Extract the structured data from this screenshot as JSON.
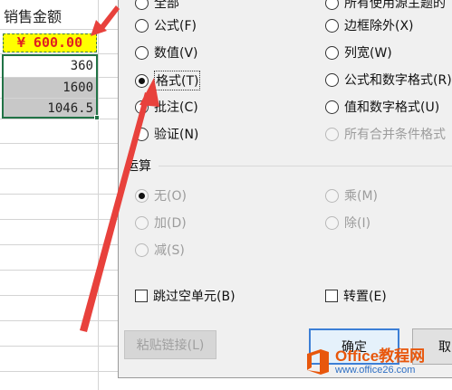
{
  "sheet": {
    "header": "销售金额",
    "price": "¥ 600.00",
    "values": [
      "360",
      "1600",
      "1046.5"
    ]
  },
  "dialog": {
    "paste_options": [
      {
        "label": "全部",
        "key": "A"
      },
      {
        "label": "所有使用源主题的",
        "key": "H"
      },
      {
        "label": "公式(F)"
      },
      {
        "label": "边框除外(X)"
      },
      {
        "label": "数值(V)"
      },
      {
        "label": "列宽(W)"
      },
      {
        "label": "格式(T)"
      },
      {
        "label": "公式和数字格式(R)"
      },
      {
        "label": "批注(C)"
      },
      {
        "label": "值和数字格式(U)"
      },
      {
        "label": "验证(N)"
      },
      {
        "label": "所有合并条件格式"
      }
    ],
    "operation_label": "运算",
    "operations": [
      {
        "label": "无(O)"
      },
      {
        "label": "乘(M)"
      },
      {
        "label": "加(D)"
      },
      {
        "label": "除(I)"
      },
      {
        "label": "减(S)"
      }
    ],
    "skip_blanks": "跳过空单元(B)",
    "transpose": "转置(E)",
    "paste_link": "粘贴链接(L)",
    "ok": "确定",
    "cancel": "取"
  },
  "watermark": {
    "brand": "Office教程网",
    "url": "www.office26.com"
  },
  "colors": {
    "arrow": "#e8413c",
    "price_bg": "#ffff00",
    "price_text": "#e02020",
    "selection": "#217346",
    "gray_fill": "#c8c8c8"
  }
}
